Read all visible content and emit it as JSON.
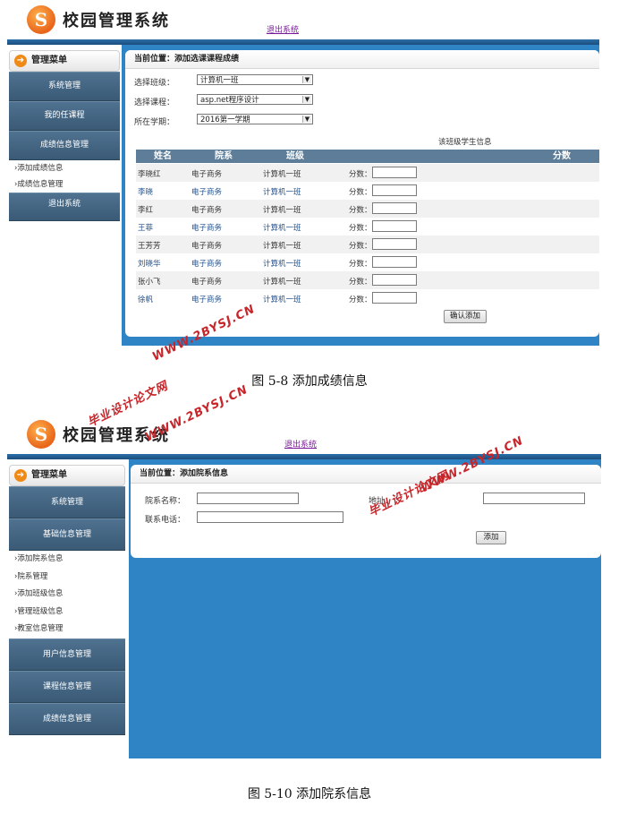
{
  "screen1": {
    "app_title": "校园管理系统",
    "logo_letter": "S",
    "logout_link": "退出系统",
    "sidebar": {
      "header": "管理菜单",
      "buttons_top": [
        "系统管理",
        "我的任课程",
        "成绩信息管理"
      ],
      "sub_items": [
        "›添加成绩信息",
        "›成绩信息管理"
      ],
      "buttons_bottom": [
        "退出系统"
      ]
    },
    "breadcrumb": "当前位置：添加选课课程成绩",
    "form": {
      "class_label": "选择班级：",
      "class_value": "计算机一班",
      "course_label": "选择课程：",
      "course_value": "asp.net程序设计",
      "term_label": "所在学期：",
      "term_value": "2016第一学期"
    },
    "table_caption": "该班级学生信息",
    "table_headers": [
      "姓名",
      "院系",
      "班级",
      "分数"
    ],
    "score_label": "分数：",
    "rows": [
      {
        "name": "李晓红",
        "dept": "电子商务",
        "class": "计算机一班"
      },
      {
        "name": "李晓",
        "dept": "电子商务",
        "class": "计算机一班"
      },
      {
        "name": "李红",
        "dept": "电子商务",
        "class": "计算机一班"
      },
      {
        "name": "王菲",
        "dept": "电子商务",
        "class": "计算机一班"
      },
      {
        "name": "王芳芳",
        "dept": "电子商务",
        "class": "计算机一班"
      },
      {
        "name": "刘晓华",
        "dept": "电子商务",
        "class": "计算机一班"
      },
      {
        "name": "张小飞",
        "dept": "电子商务",
        "class": "计算机一班"
      },
      {
        "name": "徐帆",
        "dept": "电子商务",
        "class": "计算机一班"
      }
    ],
    "submit_button": "确认添加"
  },
  "caption1": "图 5-8 添加成绩信息",
  "screen2": {
    "app_title": "校园管理系统",
    "logo_letter": "S",
    "logout_link": "退出系统",
    "sidebar": {
      "header": "管理菜单",
      "buttons_top": [
        "系统管理",
        "基础信息管理"
      ],
      "sub_items": [
        "›添加院系信息",
        "›院系管理",
        "›添加班级信息",
        "›管理班级信息",
        "›教室信息管理"
      ],
      "buttons_bottom": [
        "用户信息管理",
        "课程信息管理",
        "成绩信息管理"
      ]
    },
    "breadcrumb": "当前位置：添加院系信息",
    "form": {
      "dept_name_label": "院系名称：",
      "address_label": "地址：",
      "phone_label": "联系电话："
    },
    "add_button": "添加"
  },
  "caption2": "图 5-10 添加院系信息",
  "watermarks": [
    "WWW.2BYSJ.CN",
    "毕业设计论文网",
    "WWW.2BYSJ.CN",
    "毕业设计论文网",
    "WWW.2BYSJ.CN"
  ],
  "colors": {
    "accent_blue": "#2e84c4",
    "menu_button": "#4f7290",
    "table_header": "#5d7d98",
    "watermark": "#c8252a"
  }
}
